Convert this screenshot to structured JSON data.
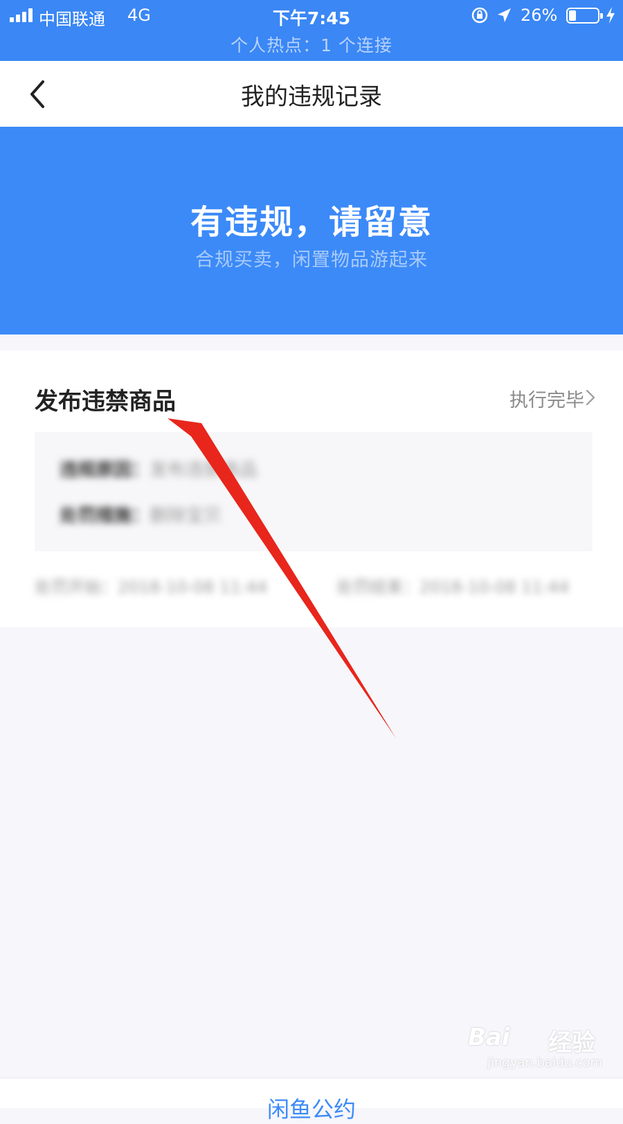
{
  "status_bar": {
    "carrier": "中国联通",
    "network": "4G",
    "time": "下午7:45",
    "battery_percent": "26%",
    "battery_level": 0.26,
    "hotspot": "个人热点：1 个连接"
  },
  "nav": {
    "title": "我的违规记录",
    "back_icon": "chevron-left-icon"
  },
  "banner": {
    "title": "有违规，请留意",
    "subtitle": "合规买卖，闲置物品游起来",
    "background": "#3c8af8"
  },
  "record": {
    "title": "发布违禁商品",
    "status": "执行完毕",
    "details": [
      {
        "key": "违规原因：",
        "value": "发布违禁商品"
      },
      {
        "key": "处罚措施：",
        "value": "删除宝贝"
      }
    ],
    "start_time": "处罚开始：2018-10-08 11:44",
    "end_time": "处罚结束：2018-10-08 11:44"
  },
  "bottom": {
    "link": "闲鱼公约"
  },
  "watermark": {
    "logo": "Bai",
    "brand": "经验",
    "url": "jingyan.baidu.com"
  },
  "colors": {
    "accent": "#3a87f5",
    "annotation_arrow": "#e8261c"
  }
}
